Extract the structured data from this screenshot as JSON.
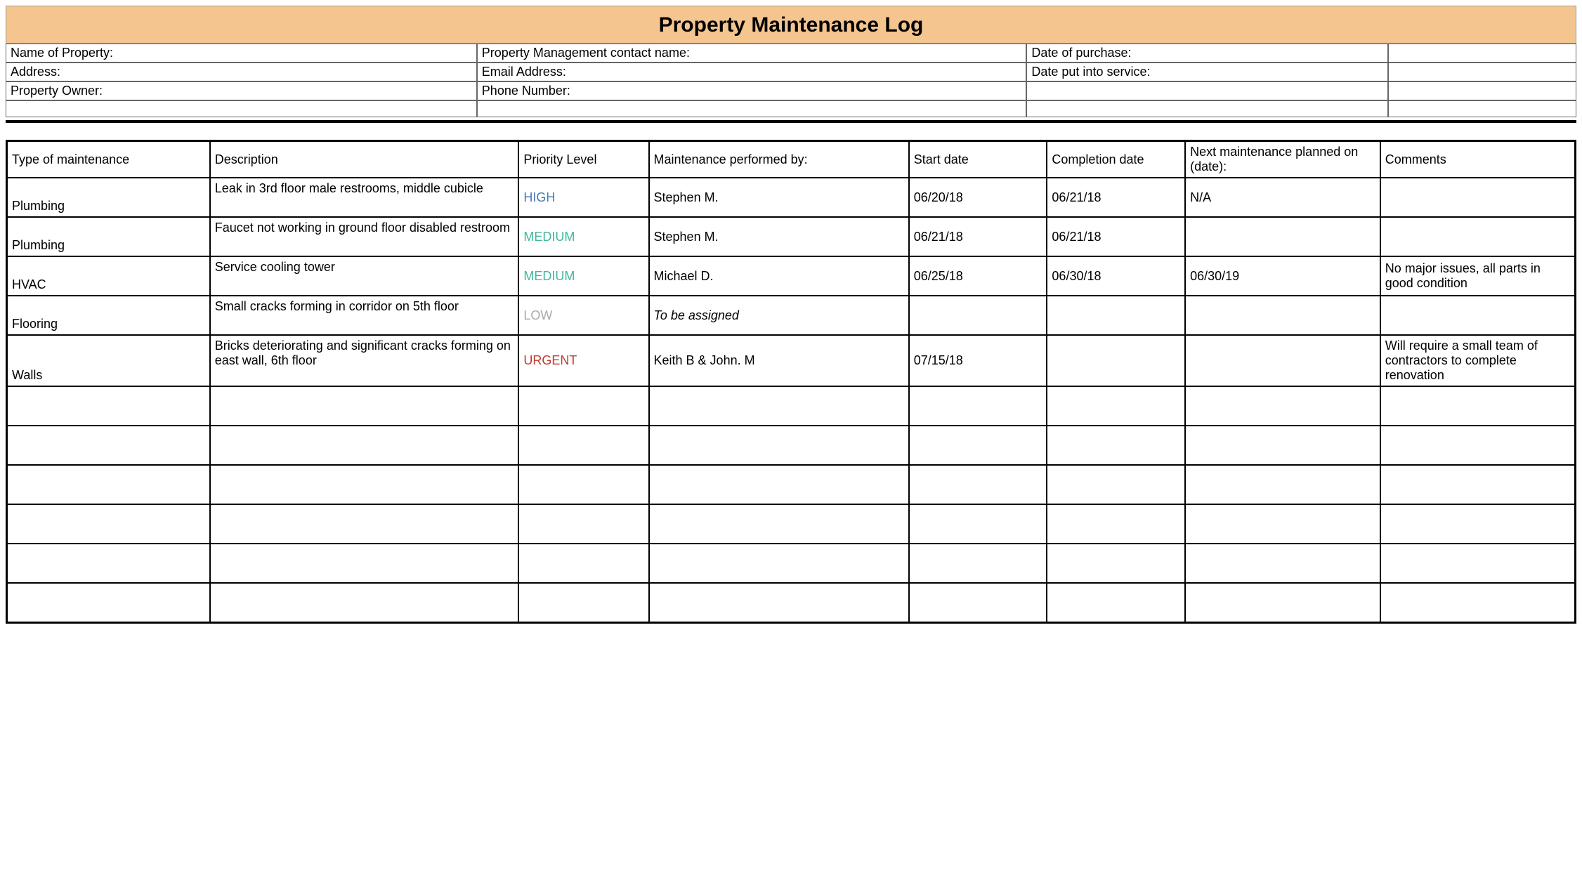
{
  "title": "Property Maintenance Log",
  "info": {
    "row1": {
      "c1": "Name of Property:",
      "c2": "Property Management contact name:",
      "c3": "Date of purchase:",
      "c4": ""
    },
    "row2": {
      "c1": "Address:",
      "c2": "Email Address:",
      "c3": "Date put into service:",
      "c4": ""
    },
    "row3": {
      "c1": "Property Owner:",
      "c2": "Phone Number:",
      "c3": "",
      "c4": ""
    },
    "row4": {
      "c1": "",
      "c2": "",
      "c3": "",
      "c4": ""
    }
  },
  "columns": {
    "type": "Type of maintenance",
    "description": "Description",
    "priority": "Priority Level",
    "performed_by": "Maintenance performed by:",
    "start_date": "Start date",
    "completion_date": "Completion date",
    "next_maintenance": "Next maintenance planned on (date):",
    "comments": "Comments"
  },
  "priority_colors": {
    "HIGH": "#4a7ab8",
    "MEDIUM": "#3fb99a",
    "LOW": "#aaaaaa",
    "URGENT": "#c0392b"
  },
  "rows": [
    {
      "type": "Plumbing",
      "description": "Leak in 3rd floor male restrooms, middle cubicle",
      "priority": "HIGH",
      "performed_by": "Stephen M.",
      "start_date": "06/20/18",
      "completion_date": "06/21/18",
      "next_maintenance": "N/A",
      "comments": "",
      "performed_italic": false
    },
    {
      "type": "Plumbing",
      "description": "Faucet not working in ground floor disabled restroom",
      "priority": "MEDIUM",
      "performed_by": "Stephen M.",
      "start_date": "06/21/18",
      "completion_date": "06/21/18",
      "next_maintenance": "",
      "comments": "",
      "performed_italic": false
    },
    {
      "type": "HVAC",
      "description": "Service cooling tower",
      "priority": "MEDIUM",
      "performed_by": "Michael D.",
      "start_date": "06/25/18",
      "completion_date": "06/30/18",
      "next_maintenance": "06/30/19",
      "comments": "No major issues, all parts in good condition",
      "performed_italic": false
    },
    {
      "type": "Flooring",
      "description": "Small cracks forming in corridor on 5th floor",
      "priority": "LOW",
      "performed_by": "To be assigned",
      "start_date": "",
      "completion_date": "",
      "next_maintenance": "",
      "comments": "",
      "performed_italic": true
    },
    {
      "type": "Walls",
      "description": "Bricks deteriorating and significant cracks forming on east wall, 6th floor",
      "priority": "URGENT",
      "performed_by": "Keith B & John. M",
      "start_date": "07/15/18",
      "completion_date": "",
      "next_maintenance": "",
      "comments": "Will require a small team of contractors to complete renovation",
      "performed_italic": false
    },
    {
      "type": "",
      "description": "",
      "priority": "",
      "performed_by": "",
      "start_date": "",
      "completion_date": "",
      "next_maintenance": "",
      "comments": "",
      "performed_italic": false
    },
    {
      "type": "",
      "description": "",
      "priority": "",
      "performed_by": "",
      "start_date": "",
      "completion_date": "",
      "next_maintenance": "",
      "comments": "",
      "performed_italic": false
    },
    {
      "type": "",
      "description": "",
      "priority": "",
      "performed_by": "",
      "start_date": "",
      "completion_date": "",
      "next_maintenance": "",
      "comments": "",
      "performed_italic": false
    },
    {
      "type": "",
      "description": "",
      "priority": "",
      "performed_by": "",
      "start_date": "",
      "completion_date": "",
      "next_maintenance": "",
      "comments": "",
      "performed_italic": false
    },
    {
      "type": "",
      "description": "",
      "priority": "",
      "performed_by": "",
      "start_date": "",
      "completion_date": "",
      "next_maintenance": "",
      "comments": "",
      "performed_italic": false
    },
    {
      "type": "",
      "description": "",
      "priority": "",
      "performed_by": "",
      "start_date": "",
      "completion_date": "",
      "next_maintenance": "",
      "comments": "",
      "performed_italic": false
    }
  ]
}
